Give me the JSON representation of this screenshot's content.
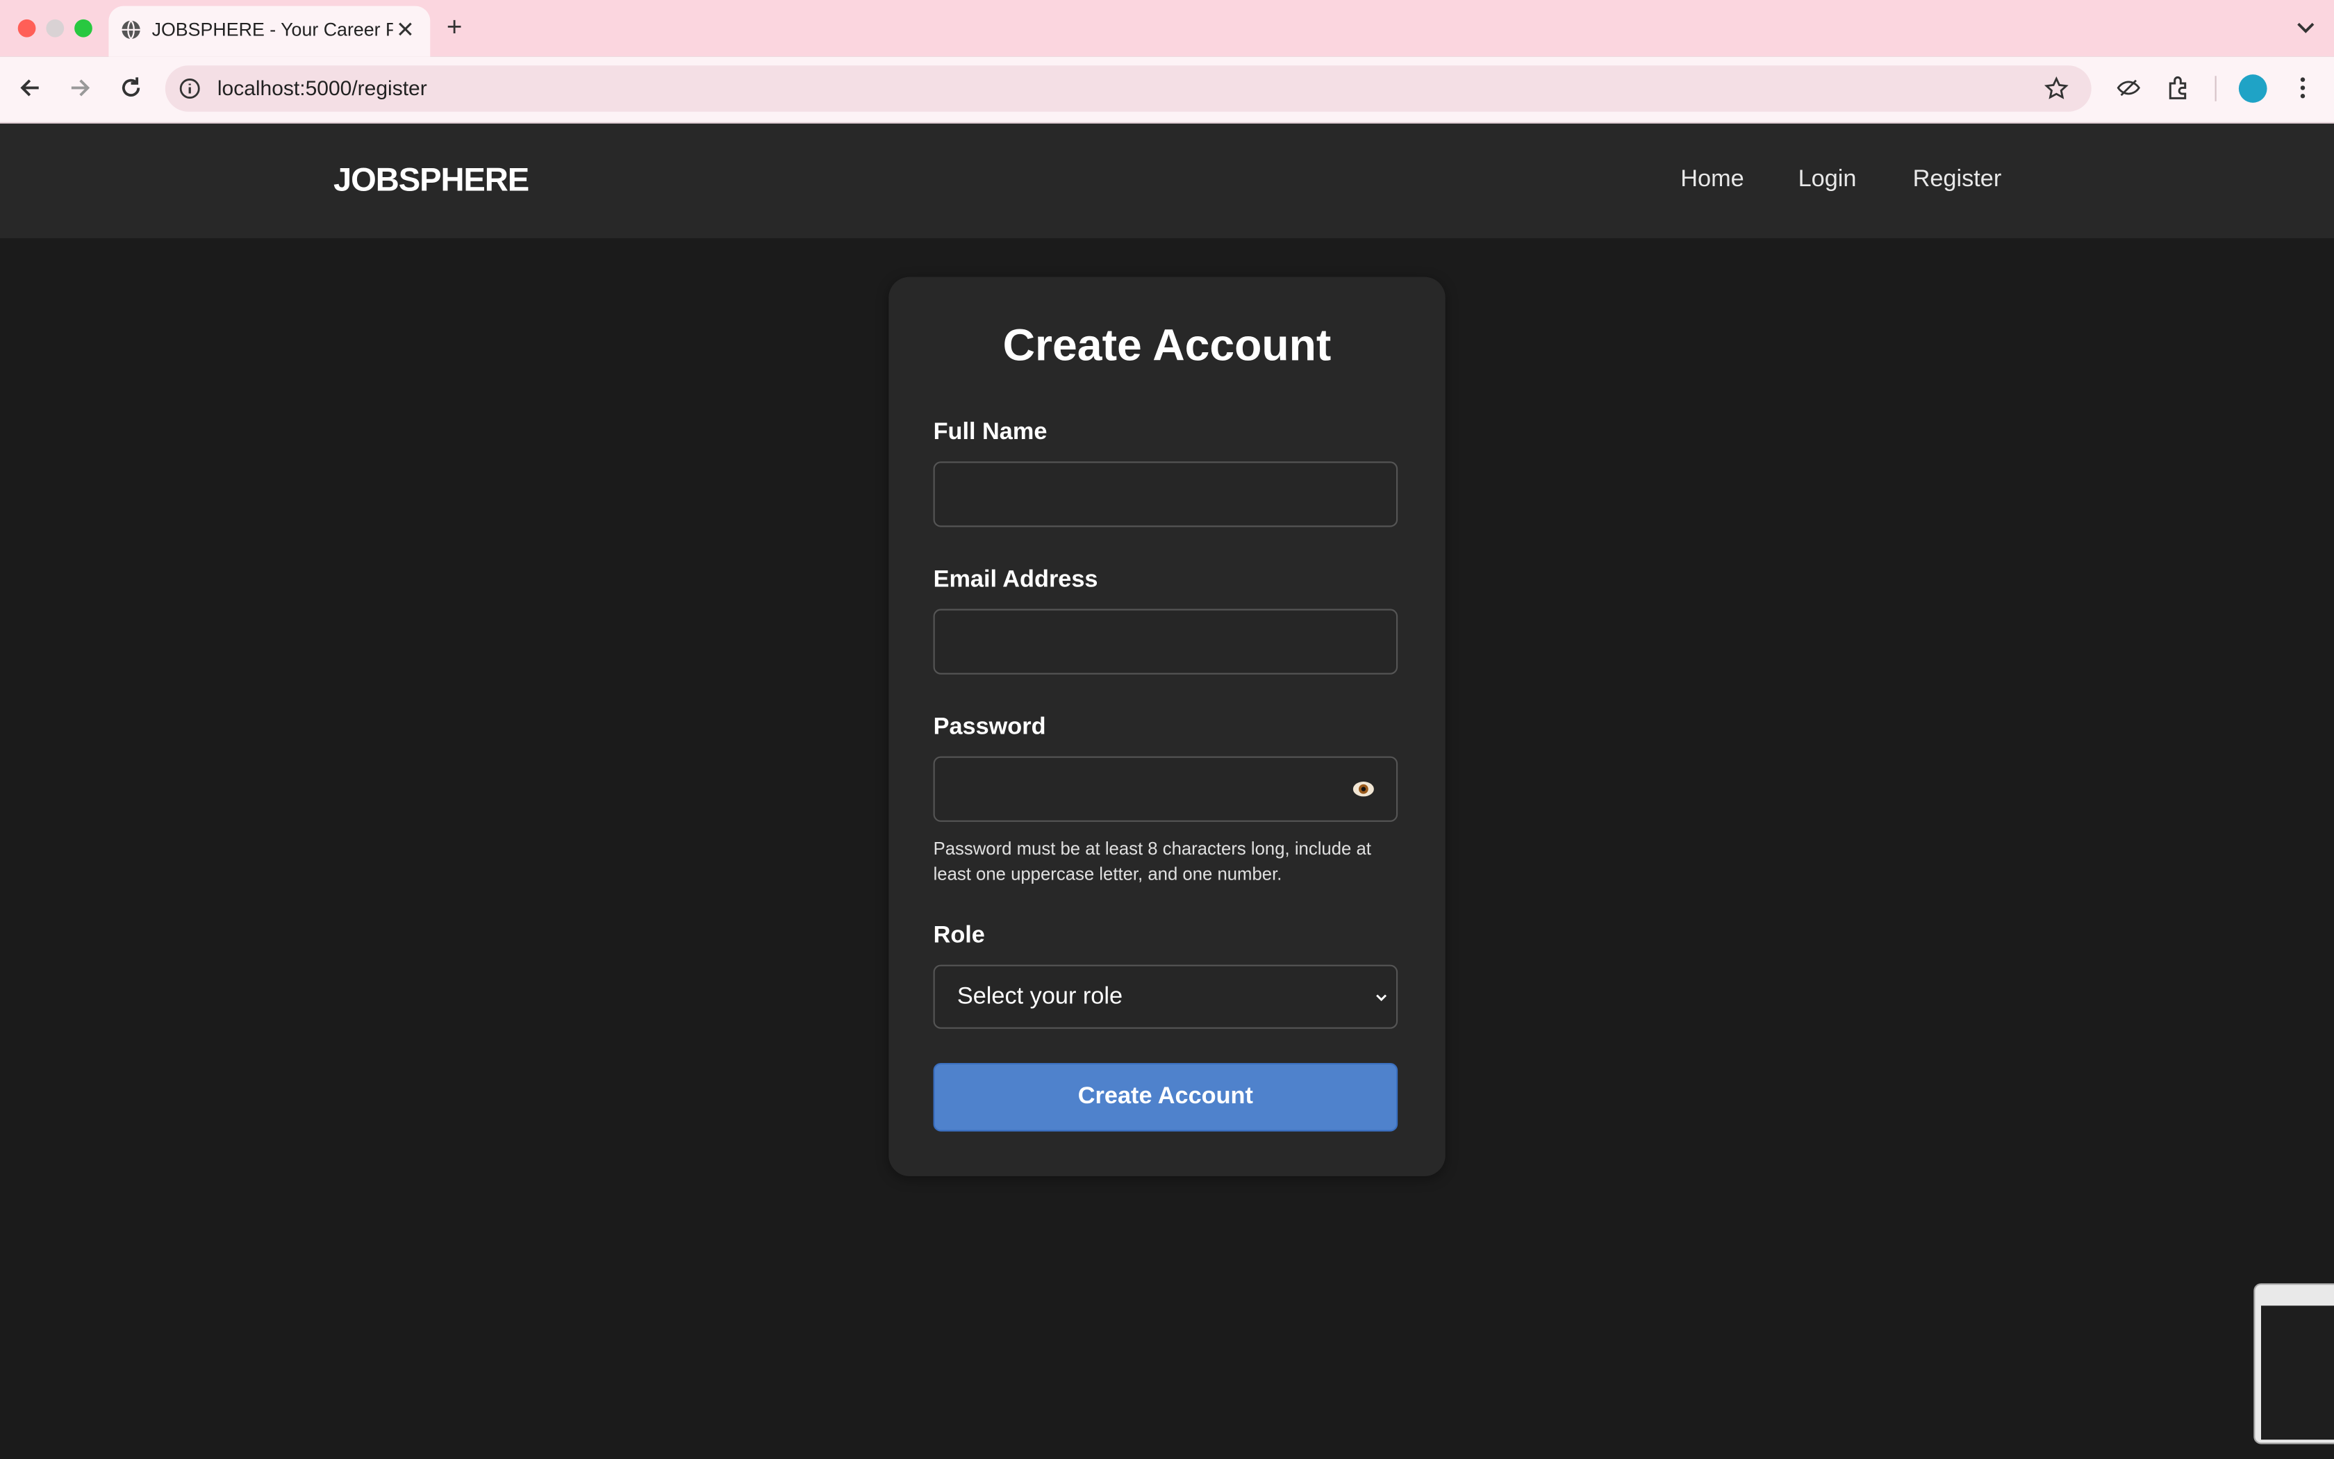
{
  "browser": {
    "tab_title": "JOBSPHERE - Your Career Pla",
    "url": "localhost:5000/register"
  },
  "site": {
    "logo": "JOBSPHERE",
    "nav": [
      "Home",
      "Login",
      "Register"
    ]
  },
  "form": {
    "title": "Create Account",
    "full_name_label": "Full Name",
    "email_label": "Email Address",
    "password_label": "Password",
    "password_hint": "Password must be at least 8 characters long, include at least one uppercase letter, and one number.",
    "role_label": "Role",
    "role_selected": "Select your role",
    "submit_label": "Create Account"
  },
  "colors": {
    "tab_bar": "#fbd6df",
    "page_bg": "#1b1b1b",
    "header_bg": "#282828",
    "card_bg": "#282828",
    "primary_button": "#4f82cc"
  }
}
